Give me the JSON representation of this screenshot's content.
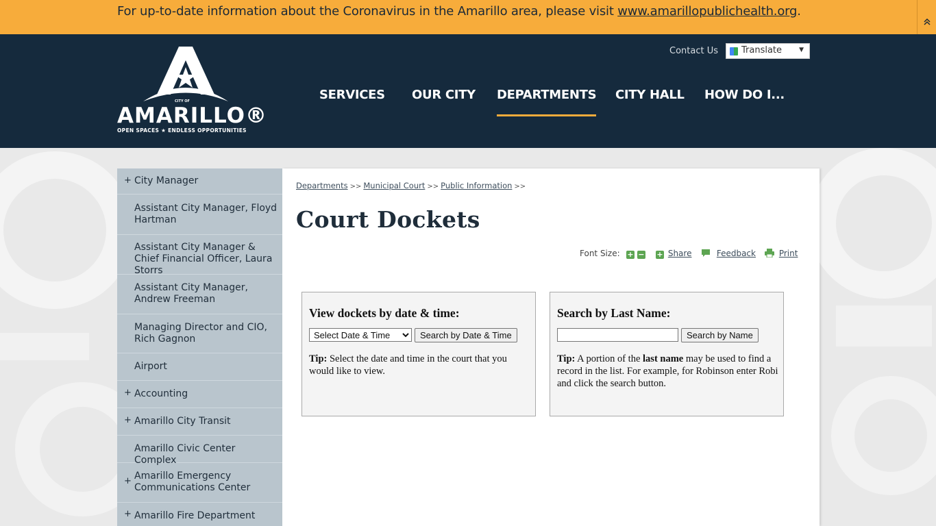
{
  "alert": {
    "text": "For up-to-date information about the Coronavirus in the Amarillo area, please visit ",
    "link": "www.amarillopublichealth.org",
    "suffix": "."
  },
  "header": {
    "logo_city_of": "CITY OF",
    "logo_word": "AMARILLO®",
    "logo_tagline": "OPEN SPACES ★ ENDLESS OPPORTUNITIES",
    "contact": "Contact Us",
    "translate": "Translate",
    "nav": [
      "SERVICES",
      "OUR CITY",
      "DEPARTMENTS",
      "CITY HALL",
      "HOW DO I..."
    ],
    "nav_active": "DEPARTMENTS",
    "accent_color": "#f7ac3b",
    "header_color": "#152a3d"
  },
  "sidebar": {
    "items": [
      {
        "label": "City Manager",
        "expandable": true
      },
      {
        "label": "Assistant City Manager, Floyd Hartman",
        "expandable": false
      },
      {
        "label": "Assistant City Manager & Chief Financial Officer, Laura Storrs",
        "expandable": false
      },
      {
        "label": "Assistant City Manager, Andrew Freeman",
        "expandable": false
      },
      {
        "label": "Managing Director and CIO, Rich Gagnon",
        "expandable": false
      },
      {
        "label": "Airport",
        "expandable": false
      },
      {
        "label": "Accounting",
        "expandable": true
      },
      {
        "label": "Amarillo City Transit",
        "expandable": true
      },
      {
        "label": "Amarillo Civic Center Complex",
        "expandable": false
      },
      {
        "label": "Amarillo Emergency Communications Center",
        "expandable": true
      },
      {
        "label": "Amarillo Fire Department",
        "expandable": true
      }
    ]
  },
  "main": {
    "breadcrumb": [
      "Departments",
      "Municipal Court",
      "Public Information"
    ],
    "breadcrumb_sep": ">>",
    "title": "Court Dockets",
    "toolbar": {
      "font_size": "Font Size:",
      "share": "Share",
      "feedback": "Feedback",
      "print": "Print"
    },
    "date_box": {
      "heading": "View dockets by date & time:",
      "select_value": "Select Date & Time",
      "button": "Search by Date & Time",
      "tip_label": "Tip:",
      "tip_text": " Select the date and time in the court that you would like to view."
    },
    "name_box": {
      "heading": "Search by Last Name:",
      "input_value": "",
      "button": "Search by Name",
      "tip_label": "Tip:",
      "tip_text_1": " A portion of the ",
      "tip_bold": "last name",
      "tip_text_2": " may be used to find a record in the list. For example, for Robinson enter Robi and click the search button."
    }
  }
}
